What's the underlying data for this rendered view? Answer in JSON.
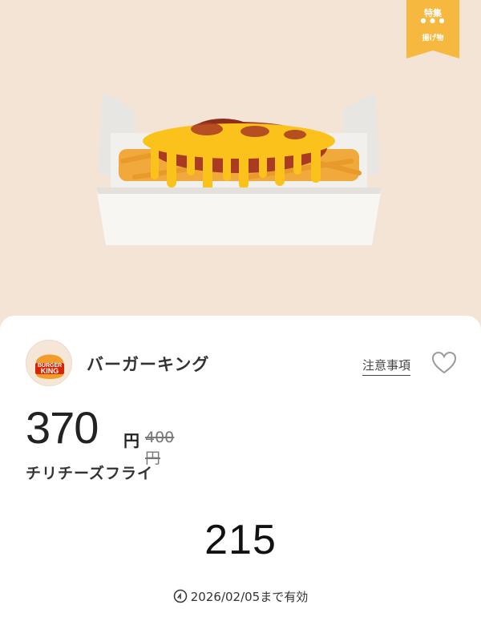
{
  "tag": {
    "line1": "特集",
    "dots": "● ● ●",
    "line2": "揚げ物",
    "color": "#f6b83f"
  },
  "hero": {
    "background": "#f3e4d6",
    "image": "chili-cheese-fries-photo"
  },
  "brand": {
    "name": "バーガーキング",
    "logo_text_top": "BURGER",
    "logo_text_bottom": "KING"
  },
  "actions": {
    "notice_label": "注意事項",
    "favorite_icon": "heart-outline-icon"
  },
  "pricing": {
    "price": "370",
    "currency": "円",
    "original_price": "400円"
  },
  "product": {
    "name": "チリチーズフライ"
  },
  "coupon": {
    "code": "215"
  },
  "validity": {
    "icon": "clock-icon",
    "text": "2026/02/05まで有効"
  }
}
